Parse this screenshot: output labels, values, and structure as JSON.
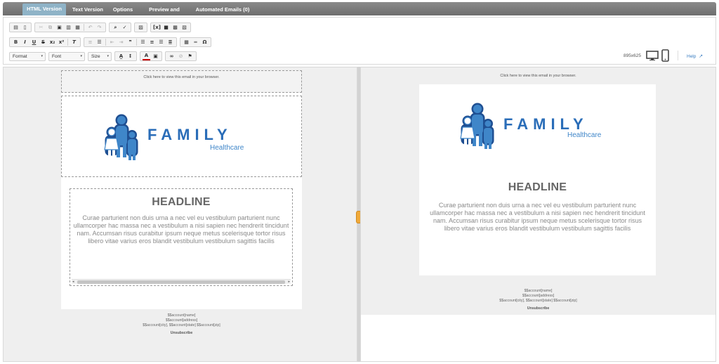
{
  "tabs": [
    {
      "label": "HTML Version",
      "active": true
    },
    {
      "label": "Text Version",
      "active": false
    },
    {
      "label": "Options",
      "active": false
    },
    {
      "label": "Preview and Test",
      "active": false
    },
    {
      "label": "Automated Emails (0)",
      "active": false
    }
  ],
  "toolbar": {
    "format_label": "Format",
    "font_label": "Font",
    "size_label": "Size"
  },
  "preview": {
    "dimensions": "895x625",
    "help_label": "Help"
  },
  "email": {
    "browser_link": "Click here to view this email in your browser.",
    "logo_word": "FAMILY",
    "logo_sub": "Healthcare",
    "headline": "HEADLINE",
    "body": "Curae parturient non duis urna a nec vel eu vestibulum parturient nunc ullamcorper hac massa nec a vestibulum a nisi sapien nec hendrerit tincidunt nam. Accumsan risus curabitur ipsum neque metus scelerisque tortor risus libero vitae varius eros blandit vestibulum vestibulum sagittis facilis",
    "footer_name": "$$account[name]",
    "footer_address": "$$account[address]",
    "footer_city": "$$account[city], $$account[state] $$account[zip]",
    "unsubscribe": "Unsubscribe"
  },
  "colors": {
    "brand": "#2a6db8",
    "accent": "#f0a93a",
    "tab_active": "#8fb3c7"
  }
}
